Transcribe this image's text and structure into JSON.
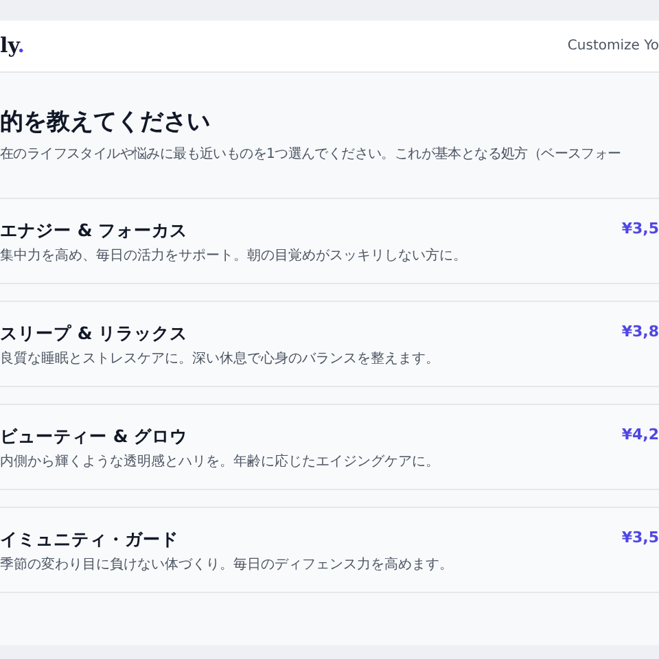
{
  "header": {
    "logo": {
      "text": "ly",
      "accent": "."
    },
    "link": "Customize Yo"
  },
  "heading": "的を教えてください",
  "subtitle": "在のライフスタイルや悩みに最も近いものを1つ選んでください。これが基本となる処方（ベースフォー",
  "options": [
    {
      "name": "エナジー & フォーカス",
      "description": "集中力を高め、毎日の活力をサポート。朝の目覚めがスッキリしない方に。",
      "price": "¥3,5"
    },
    {
      "name": "スリープ & リラックス",
      "description": "良質な睡眠とストレスケアに。深い休息で心身のバランスを整えます。",
      "price": "¥3,8"
    },
    {
      "name": "ビューティー & グロウ",
      "description": "内側から輝くような透明感とハリを。年齢に応じたエイジングケアに。",
      "price": "¥4,2"
    },
    {
      "name": "イミュニティ・ガード",
      "description": "季節の変わり目に負けない体づくり。毎日のディフェンス力を高めます。",
      "price": "¥3,5"
    }
  ]
}
